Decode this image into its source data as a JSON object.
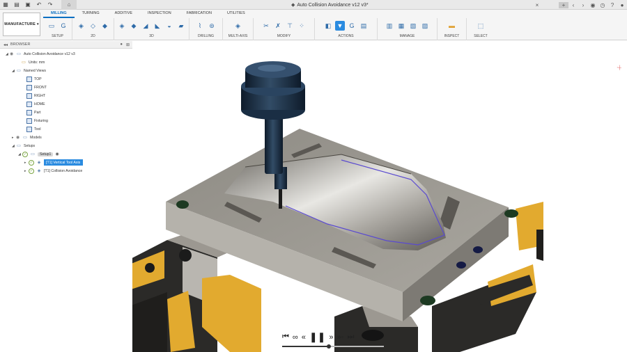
{
  "window": {
    "title": "Auto Collision Avoidance v12 v3*"
  },
  "workspace": {
    "label": "MANUFACTURE"
  },
  "tabs": [
    {
      "label": "MILLING",
      "active": true
    },
    {
      "label": "TURNING"
    },
    {
      "label": "ADDITIVE"
    },
    {
      "label": "INSPECTION"
    },
    {
      "label": "FABRICATION"
    },
    {
      "label": "UTILITIES"
    }
  ],
  "groups": [
    "SETUP",
    "2D",
    "3D",
    "DRILLING",
    "MULTI-AXIS",
    "MODIFY",
    "ACTIONS",
    "MANAGE",
    "INSPECT",
    "SELECT"
  ],
  "browser": {
    "title": "BROWSER",
    "doc_name": "Auto Collision Avoidance v12 v3",
    "units": "Units: mm",
    "named_views": "Named Views",
    "views": [
      "TOP",
      "FRONT",
      "RIGHT",
      "HOME",
      "Part",
      "Fixturing",
      "Tool"
    ],
    "models": "Models",
    "setups": "Setups",
    "setup1": "Setup1",
    "op1": "[T1] Vertical Tool Axis",
    "op2": "[T1] Collision Avoidance"
  },
  "playback": {
    "progress": 0.46
  },
  "colors": {
    "accent": "#2a8be0",
    "clamp": "#e2aa2f",
    "part": "#9d9a93"
  }
}
